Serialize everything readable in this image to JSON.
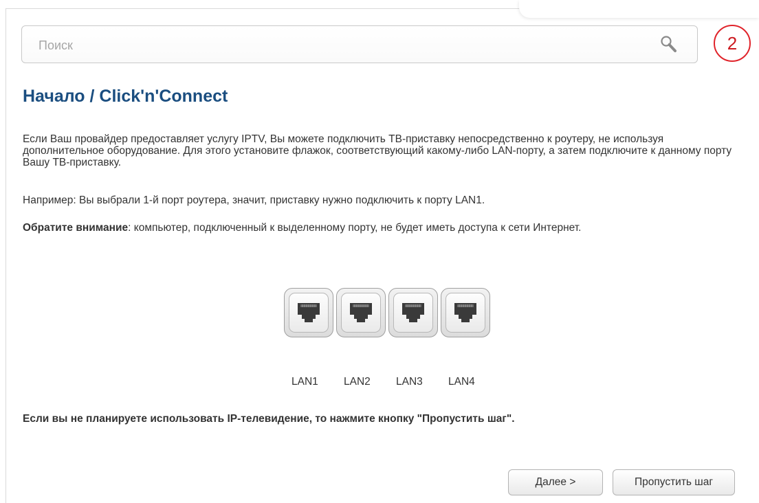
{
  "search": {
    "placeholder": "Поиск",
    "value": ""
  },
  "step_badge": "2",
  "page": {
    "title": "Начало /  Click'n'Connect",
    "paragraph1": "Если Ваш провайдер предоставляет услугу IPTV, Вы можете подключить ТВ-приставку непосредственно к роутеру, не используя дополнительное оборудование. Для этого установите флажок, соответствующий какому-либо LAN-порту, а затем подключите к данному порту Вашу ТВ-приставку.",
    "paragraph2": "Например: Вы выбрали 1-й порт роутера, значит, приставку нужно подключить к порту LAN1.",
    "attention_label": "Обратите внимание",
    "attention_text": ": компьютер, подключенный к выделенному порту, не будет иметь доступа к сети Интернет.",
    "note": "Если вы не планируете использовать IP-телевидение, то нажмите кнопку \"Пропустить шаг\"."
  },
  "ports": [
    {
      "label": "LAN1",
      "selected": false
    },
    {
      "label": "LAN2",
      "selected": false
    },
    {
      "label": "LAN3",
      "selected": false
    },
    {
      "label": "LAN4",
      "selected": false
    }
  ],
  "buttons": {
    "next": "Далее >",
    "skip": "Пропустить шаг"
  },
  "colors": {
    "title": "#1b4e80",
    "badge": "#e0232a",
    "port_jack": "#3a3a3a"
  }
}
